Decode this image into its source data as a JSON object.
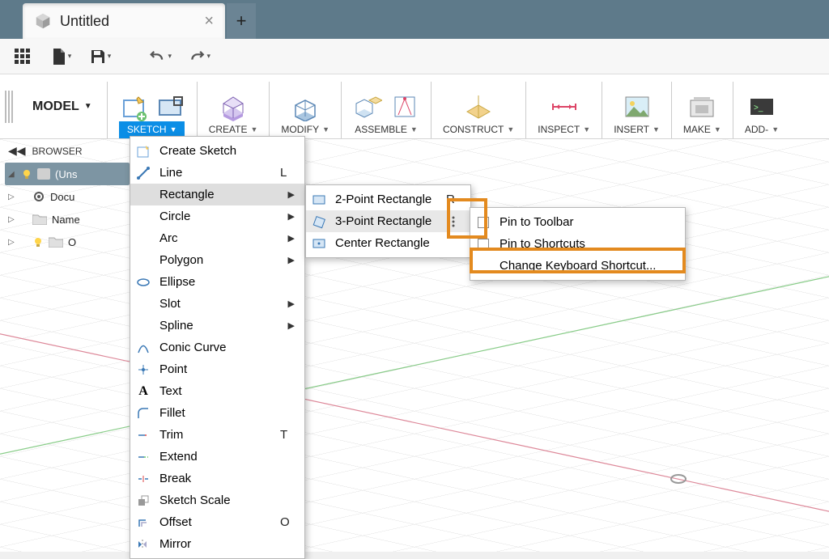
{
  "tab": {
    "title": "Untitled"
  },
  "modelLabel": "MODEL",
  "ribbon": {
    "sketch": "SKETCH",
    "create": "CREATE",
    "modify": "MODIFY",
    "assemble": "ASSEMBLE",
    "construct": "CONSTRUCT",
    "inspect": "INSPECT",
    "insert": "INSERT",
    "make": "MAKE",
    "addins": "ADD-"
  },
  "browser": {
    "title": "BROWSER",
    "root": "(Uns",
    "documents": "Docu",
    "named": "Name",
    "origin": "O"
  },
  "sketchMenu": {
    "createSketch": "Create Sketch",
    "line": "Line",
    "lineKey": "L",
    "rectangle": "Rectangle",
    "circle": "Circle",
    "arc": "Arc",
    "polygon": "Polygon",
    "ellipse": "Ellipse",
    "slot": "Slot",
    "spline": "Spline",
    "conic": "Conic Curve",
    "point": "Point",
    "text": "Text",
    "fillet": "Fillet",
    "trim": "Trim",
    "trimKey": "T",
    "extend": "Extend",
    "break": "Break",
    "scale": "Sketch Scale",
    "offset": "Offset",
    "offsetKey": "O",
    "mirror": "Mirror"
  },
  "rectMenu": {
    "twoPoint": "2-Point Rectangle",
    "twoPointKey": "R",
    "threePoint": "3-Point Rectangle",
    "center": "Center Rectangle"
  },
  "ctxMenu": {
    "pinToolbar": "Pin to Toolbar",
    "pinShortcuts": "Pin to Shortcuts",
    "changeShortcut": "Change Keyboard Shortcut..."
  }
}
